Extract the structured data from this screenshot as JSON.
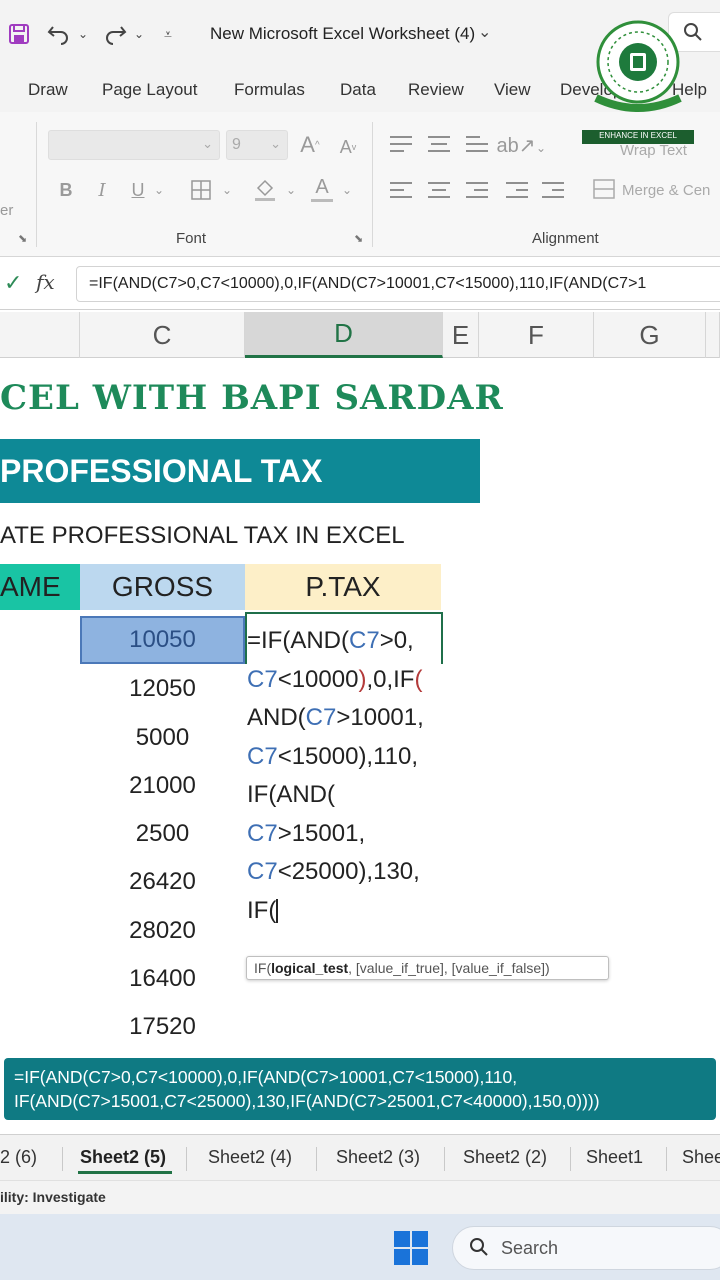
{
  "titlebar": {
    "doc_title": "New Microsoft Excel Worksheet (4)"
  },
  "ribbon_tabs": [
    "Draw",
    "Page Layout",
    "Formulas",
    "Data",
    "Review",
    "View",
    "Developer",
    "Help"
  ],
  "ribbon": {
    "font_size": "9",
    "grow_font": "A",
    "shrink_font": "A",
    "bold": "B",
    "italic": "I",
    "underline": "U",
    "font_color": "A",
    "clipboard_partial": "er",
    "font_group_label": "Font",
    "alignment_group_label": "Alignment",
    "wrap_text": "Wrap Text",
    "merge_center": "Merge & Cen"
  },
  "formula_bar": {
    "fx": "fx",
    "text": "=IF(AND(C7>0,C7<10000),0,IF(AND(C7>10001,C7<15000),110,IF(AND(C7>1"
  },
  "columns": [
    "C",
    "D",
    "E",
    "F",
    "G"
  ],
  "sheet": {
    "brand_title": "CEL WITH BAPI SARDAR",
    "banner": "PROFESSIONAL TAX",
    "subtitle": "ATE PROFESSIONAL TAX IN EXCEL",
    "headers": {
      "name": "AME",
      "gross": "GROSS",
      "ptax": "P.TAX"
    },
    "gross_values": [
      "10050",
      "12050",
      "5000",
      "21000",
      "2500",
      "26420",
      "28020",
      "16400",
      "17520"
    ]
  },
  "formula_edit": {
    "line1_a": "=IF(AND(",
    "line1_ref": "C7",
    "line1_b": ">0,",
    "line2_ref": "C7",
    "line2_b": "<10000",
    "line2_par": ")",
    "line2_c": ",0,IF",
    "line2_par2": "(",
    "line3_a": "AND(",
    "line3_ref": "C7",
    "line3_b": ">10001,",
    "line4_ref": "C7",
    "line4_b": "<15000),110,",
    "line5_a": "IF(AND(",
    "line6_ref": "C7",
    "line6_b": ">15001,",
    "line7_ref": "C7",
    "line7_b": "<25000),130,",
    "line8_a": "IF("
  },
  "tooltip": {
    "fn": "IF(",
    "arg1": "logical_test",
    "rest": ", [value_if_true], [value_if_false])"
  },
  "caption": {
    "line1": "=IF(AND(C7>0,C7<10000),0,IF(AND(C7>10001,C7<15000),110,",
    "line2": "IF(AND(C7>15001,C7<25000),130,IF(AND(C7>25001,C7<40000),150,0))))"
  },
  "sheet_tabs": [
    "2 (6)",
    "Sheet2 (5)",
    "Sheet2 (4)",
    "Sheet2 (3)",
    "Sheet2 (2)",
    "Sheet1",
    "Shee"
  ],
  "status": {
    "text": "ility: Investigate"
  },
  "taskbar": {
    "search_label": "Search"
  },
  "logo": {
    "text": "ENHANCE IN EXCEL"
  }
}
